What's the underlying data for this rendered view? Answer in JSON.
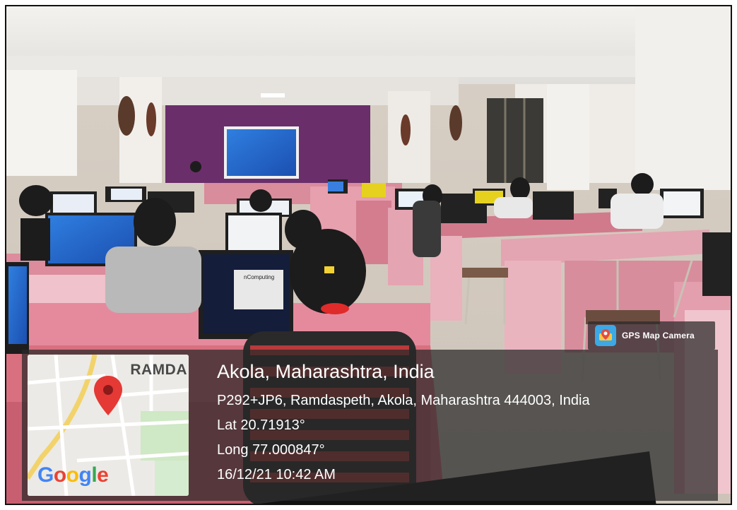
{
  "badge": {
    "label": "GPS Map Camera",
    "icon": "gps-map-camera-icon"
  },
  "location": {
    "title": "Akola, Maharashtra, India",
    "address": "P292+JP6, Ramdaspeth, Akola, Maharashtra 444003, India",
    "latitude": "Lat 20.71913°",
    "longitude": "Long 77.000847°",
    "timestamp": "16/12/21 10:42 AM"
  },
  "map": {
    "area_label": "RAMDA",
    "logo_text": [
      "G",
      "o",
      "o",
      "g",
      "l",
      "e"
    ],
    "logo_colors": [
      "#4285F4",
      "#EA4335",
      "#FBBC05",
      "#4285F4",
      "#34A853",
      "#EA4335"
    ],
    "pin_color": "#e53935",
    "icon": "location-pin-icon"
  },
  "photo": {
    "screen_text": "nComputing"
  }
}
